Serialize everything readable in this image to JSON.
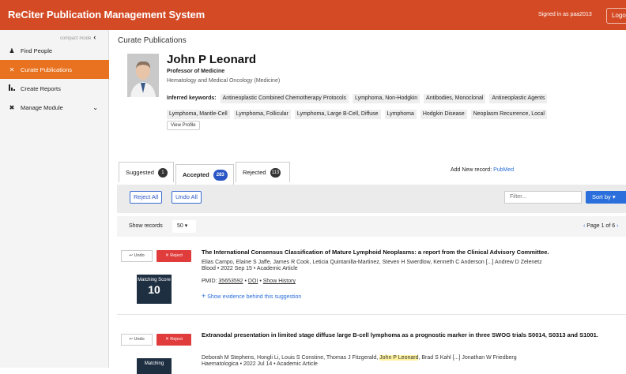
{
  "app": {
    "title": "ReCiter Publication Management System",
    "signed_in": "Signed in as paa2013",
    "logout": "Logout"
  },
  "sidebar": {
    "compact_mode": "compact mode",
    "items": [
      {
        "label": "Find People",
        "icon": "people-icon"
      },
      {
        "label": "Curate Publications",
        "icon": "tools-icon"
      },
      {
        "label": "Create Reports",
        "icon": "chart-icon"
      },
      {
        "label": "Manage Module",
        "icon": "wrench-icon"
      }
    ]
  },
  "page": {
    "breadcrumb": "Curate Publications",
    "profile": {
      "name": "John P Leonard",
      "title": "Professor of Medicine",
      "department": "Hematology and Medical Oncology (Medicine)",
      "keywords_label": "Inferred keywords:",
      "keywords": [
        "Antineoplastic Combined Chemotherapy Protocols",
        "Lymphoma, Non-Hodgkin",
        "Antibodies, Monoclonal",
        "Antineoplastic Agents",
        "Lymphoma, Mantle-Cell",
        "Lymphoma, Follicular",
        "Lymphoma, Large B-Cell, Diffuse",
        "Lymphoma",
        "Hodgkin Disease",
        "Neoplasm Recurrence, Local"
      ],
      "view_profile": "View Profile"
    },
    "tabs": [
      {
        "label": "Suggested",
        "count": "1"
      },
      {
        "label": "Accepted",
        "count": "283"
      },
      {
        "label": "Rejected",
        "count": "113"
      }
    ],
    "add_new_label": "Add New record:",
    "add_new_link": "PubMed",
    "toolbar": {
      "reject_all": "Reject All",
      "undo_all": "Undo All",
      "filter_placeholder": "Filter...",
      "sort_by": "Sort by ▾"
    },
    "pager": {
      "show_records": "Show records",
      "per_page": "50 ▾",
      "page_info": "Page 1 of 6",
      "prev": "‹",
      "next": "›"
    },
    "publications": [
      {
        "undo": "↩ Undo",
        "reject": "✕ Reject",
        "score_label": "Matching Score",
        "score": "10",
        "title": "The International Consensus Classification of Mature Lymphoid Neoplasms: a report from the Clinical Advisory Committee.",
        "authors": "Elias Campo, Elaine S Jaffe, James R Cook, Leticia Quintanilla-Martinez, Steven H Swerdlow, Kenneth C Anderson [...] Andrew D Zelenetz",
        "meta": "Blood • 2022 Sep 15 • Academic Article",
        "pmid_label": "PMID:",
        "pmid": "35653592",
        "doi": "DOI",
        "show_history": "Show History",
        "evidence": "Show evidence behind this suggestion"
      },
      {
        "undo": "↩ Undo",
        "reject": "✕ Reject",
        "score_label": "Matching",
        "title": "Extranodal presentation in limited stage diffuse large B-cell lymphoma as a prognostic marker in three SWOG trials S0014, S0313 and S1001.",
        "authors_pre": "Deborah M Stephens, Hongli Li, Louis S Constine, Thomas J Fitzgerald,",
        "authors_hl": "John P Leonard",
        "authors_post": ", Brad S Kahl [...] Jonathan W Friedberg",
        "meta": "Haematologica • 2022 Jul 14 • Academic Article"
      }
    ]
  }
}
